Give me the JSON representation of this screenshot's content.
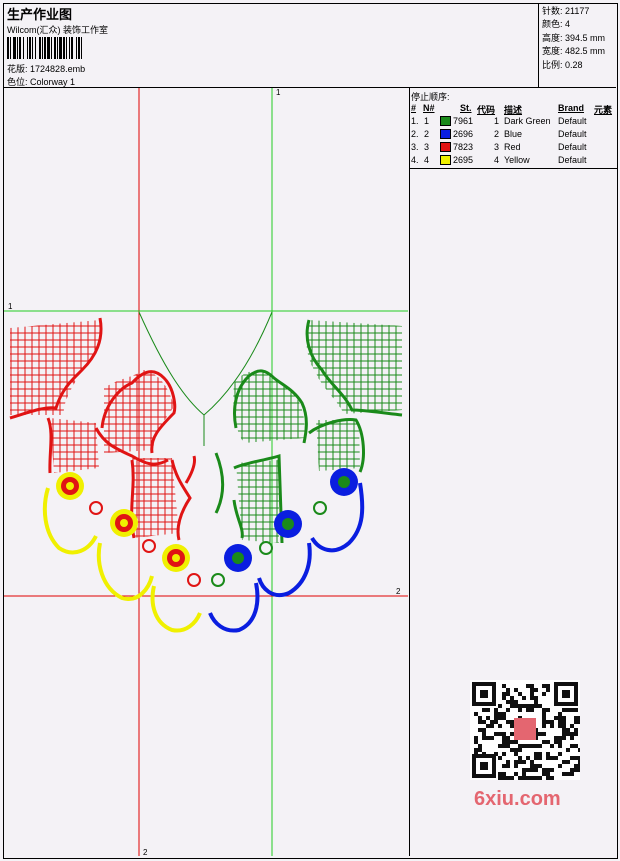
{
  "header": {
    "title": "生产作业图",
    "studio": "Wilcom(汇众) 装饰工作室",
    "design_label": "花版:",
    "design_value": "1724828.emb",
    "colorway_label": "色位:",
    "colorway_value": "Colorway 1"
  },
  "stats": [
    {
      "label": "针数:",
      "value": "21177"
    },
    {
      "label": "颜色:",
      "value": "4"
    },
    {
      "label": "高度:",
      "value": "394.5 mm"
    },
    {
      "label": "宽度:",
      "value": "482.5 mm"
    },
    {
      "label": "比例:",
      "value": "0.28"
    }
  ],
  "stop_sequence": {
    "title": "停止顺序:",
    "headers": {
      "num": "#",
      "needle": "N#",
      "stitch": "St.",
      "code": "代码",
      "desc": "描述",
      "brand": "Brand",
      "element": "元素"
    },
    "rows": [
      {
        "num": "1.",
        "needle": "1",
        "color": "#1a8a1a",
        "stitch": "7961",
        "code": "1",
        "desc": "Dark Green",
        "brand": "Default"
      },
      {
        "num": "2.",
        "needle": "2",
        "color": "#0a1ee0",
        "stitch": "2696",
        "code": "2",
        "desc": "Blue",
        "brand": "Default"
      },
      {
        "num": "3.",
        "needle": "3",
        "color": "#e01414",
        "stitch": "7823",
        "code": "3",
        "desc": "Red",
        "brand": "Default"
      },
      {
        "num": "4.",
        "needle": "4",
        "color": "#f0f000",
        "stitch": "2695",
        "code": "4",
        "desc": "Yellow",
        "brand": "Default"
      }
    ]
  },
  "guides": {
    "v1": "1",
    "h1": "1",
    "h2": "2",
    "v2": "2"
  },
  "watermark": {
    "logo": "6xiu.com"
  },
  "colors": {
    "green": "#1a8a1a",
    "blue": "#0a1ee0",
    "red": "#e01414",
    "yellow": "#f0f000",
    "guide_red": "#e00000",
    "guide_green": "#22cc22"
  }
}
